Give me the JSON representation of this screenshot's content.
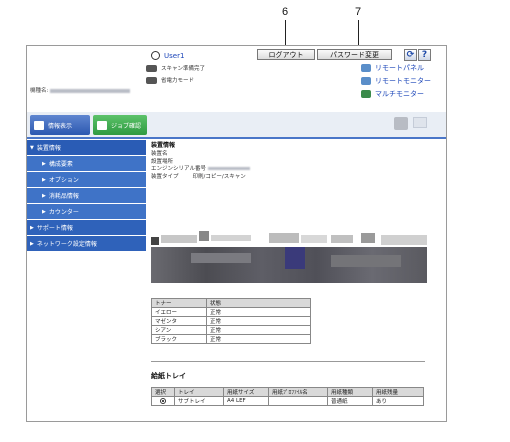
{
  "callouts": {
    "logout_num": "6",
    "password_num": "7"
  },
  "header": {
    "user": "User1",
    "logout": "ログアウト",
    "password_change": "パスワード変更",
    "refresh_icon": "refresh-icon",
    "help": "?",
    "status_scan": "スキャン準備完了",
    "status_power": "省電力モード",
    "remote_panel": "リモートパネル",
    "remote_monitor": "リモートモニター",
    "multi_monitor": "マルチモニター"
  },
  "device_name_label": "機種名:",
  "tabs": {
    "info": "情報表示",
    "job": "ジョブ確認"
  },
  "sidebar": {
    "items": [
      {
        "label": "装置情報",
        "kind": "head"
      },
      {
        "label": "構成要素",
        "kind": "sub"
      },
      {
        "label": "オプション",
        "kind": "sub"
      },
      {
        "label": "消耗品情報",
        "kind": "sub"
      },
      {
        "label": "カウンター",
        "kind": "sub"
      },
      {
        "label": "サポート情報",
        "kind": "top"
      },
      {
        "label": "ネットワーク設定情報",
        "kind": "top"
      }
    ]
  },
  "main": {
    "title": "装置情報",
    "fields": [
      "装置名",
      "設置場所",
      "エンジンシリアル番号",
      "装置タイプ"
    ],
    "device_type_value": "印刷/コピー/スキャン"
  },
  "toner_table": {
    "headers": [
      "トナー",
      "状態"
    ],
    "rows": [
      [
        "イエロー",
        "正常"
      ],
      [
        "マゼンタ",
        "正常"
      ],
      [
        "シアン",
        "正常"
      ],
      [
        "ブラック",
        "正常"
      ]
    ]
  },
  "tray_section": {
    "title": "給紙トレイ",
    "headers": [
      "選択",
      "トレイ",
      "用紙サイズ",
      "用紙ﾌﾟﾛﾌｧｲﾙ名",
      "用紙種類",
      "用紙残量"
    ],
    "row": [
      "",
      "サブトレイ",
      "A4 LEF",
      "",
      "普通紙",
      "あり"
    ]
  }
}
